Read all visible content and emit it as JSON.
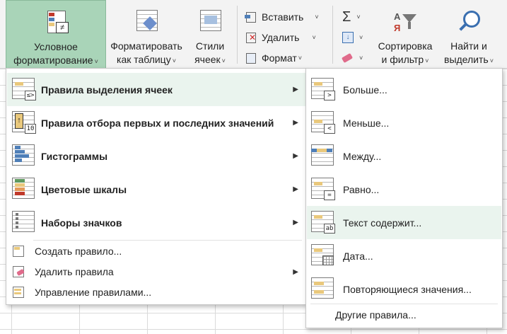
{
  "ribbon": {
    "conditional_formatting": {
      "line1": "Условное",
      "line2": "форматирование"
    },
    "format_as_table": {
      "line1": "Форматировать",
      "line2": "как таблицу"
    },
    "cell_styles": {
      "line1": "Стили",
      "line2": "ячеек"
    },
    "insert_label": "Вставить",
    "delete_label": "Удалить",
    "format_label": "Формат",
    "sort_filter": {
      "line1": "Сортировка",
      "line2": "и фильтр"
    },
    "find_select": {
      "line1": "Найти и",
      "line2": "выделить"
    },
    "caret": "˅"
  },
  "menu": {
    "items": [
      {
        "label": "Правила выделения ячеек",
        "has_submenu": true
      },
      {
        "label": "Правила отбора первых и последних значений",
        "has_submenu": true
      },
      {
        "label": "Гистограммы",
        "has_submenu": true
      },
      {
        "label": "Цветовые шкалы",
        "has_submenu": true
      },
      {
        "label": "Наборы значков",
        "has_submenu": true
      }
    ],
    "actions": [
      {
        "label": "Создать правило...",
        "has_submenu": false
      },
      {
        "label": "Удалить правила",
        "has_submenu": true
      },
      {
        "label": "Управление правилами...",
        "has_submenu": false
      }
    ],
    "arrow": "▶",
    "top_bottom_badge": "10"
  },
  "submenu": {
    "items": [
      {
        "label": "Больше...",
        "symbol": ">"
      },
      {
        "label": "Меньше...",
        "symbol": "<"
      },
      {
        "label": "Между...",
        "symbol": ""
      },
      {
        "label": "Равно...",
        "symbol": "="
      },
      {
        "label": "Текст содержит...",
        "symbol": "ab"
      },
      {
        "label": "Дата...",
        "symbol": ""
      },
      {
        "label": "Повторяющиеся значения...",
        "symbol": ""
      }
    ],
    "other_rules": "Другие правила..."
  },
  "colors": {
    "accent": "#a9d4b8",
    "hover": "#eaf4ee",
    "highlight": "#e9c87c",
    "blue": "#4f7fb8"
  }
}
